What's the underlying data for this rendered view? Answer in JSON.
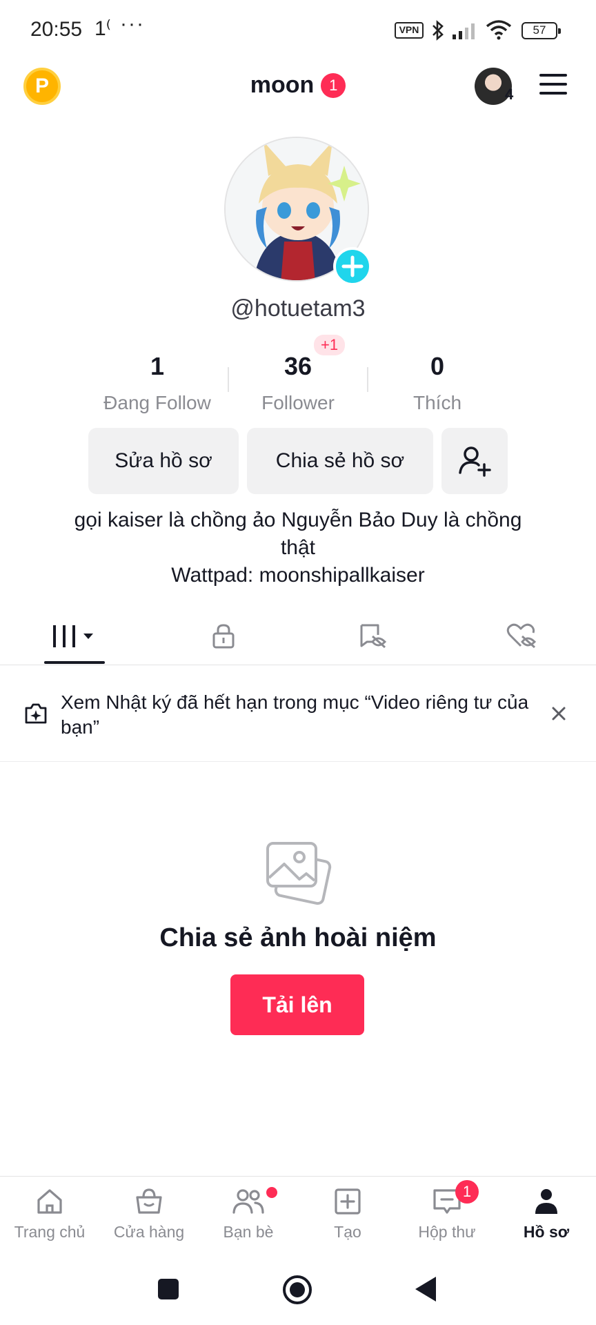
{
  "status_bar": {
    "time": "20:55",
    "extra": "1⁽",
    "dots": "···",
    "vpn": "VPN",
    "battery": "57"
  },
  "header": {
    "coin_letter": "P",
    "username": "moon",
    "notification_count": "1",
    "accounts_count": "4"
  },
  "profile": {
    "handle": "@hotuetam3",
    "stats": [
      {
        "value": "1",
        "label": "Đang Follow"
      },
      {
        "value": "36",
        "label": "Follower",
        "badge": "+1"
      },
      {
        "value": "0",
        "label": "Thích"
      }
    ],
    "edit_label": "Sửa hồ sơ",
    "share_label": "Chia sẻ hồ sơ",
    "bio_line1": "gọi kaiser là chồng ảo Nguyễn Bảo Duy là chồng",
    "bio_line2": "thật",
    "bio_line3": "Wattpad: moonshipallkaiser"
  },
  "tabs": [
    "videos-grid-icon",
    "lock-icon",
    "hidden-repost-icon",
    "hidden-like-icon"
  ],
  "notice": {
    "text": "Xem Nhật ký đã hết hạn trong mục “Video riêng tư của bạn”"
  },
  "empty_state": {
    "title": "Chia sẻ ảnh hoài niệm",
    "upload_label": "Tải lên"
  },
  "bottom_nav": {
    "items": [
      {
        "label": "Trang chủ",
        "icon": "home-icon"
      },
      {
        "label": "Cửa hàng",
        "icon": "shop-icon"
      },
      {
        "label": "Bạn bè",
        "icon": "friends-icon"
      },
      {
        "label": "Tạo",
        "icon": "create-icon"
      },
      {
        "label": "Hộp thư",
        "icon": "inbox-icon",
        "badge": "1"
      },
      {
        "label": "Hồ sơ",
        "icon": "profile-icon"
      }
    ]
  },
  "colors": {
    "accent": "#fe2c55",
    "cyan": "#20d5ec",
    "text": "#161823",
    "muted": "#8a8b91"
  }
}
